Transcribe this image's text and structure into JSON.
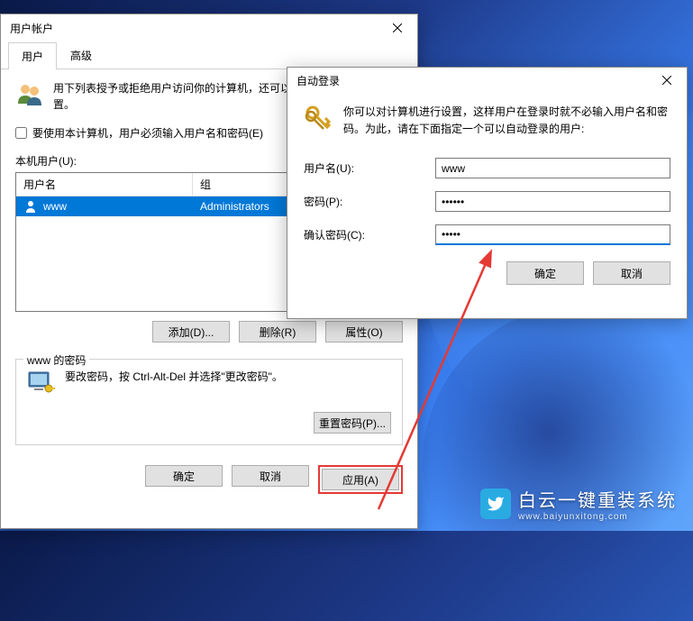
{
  "ua": {
    "title": "用户帐户",
    "tabs": {
      "users": "用户",
      "advanced": "高级"
    },
    "intro": "用下列表授予或拒绝用户访问你的计算机，还可以更改其密码和其他设置。",
    "checkbox": "要使用本计算机，用户必须输入用户名和密码(E)",
    "list_label": "本机用户(U):",
    "cols": {
      "name": "用户名",
      "group": "组"
    },
    "row": {
      "name": "www",
      "group": "Administrators"
    },
    "btns": {
      "add": "添加(D)...",
      "remove": "删除(R)",
      "props": "属性(O)"
    },
    "pw_legend": "www 的密码",
    "pw_text": "要改密码，按 Ctrl-Alt-Del 并选择\"更改密码\"。",
    "reset": "重置密码(P)...",
    "ok": "确定",
    "cancel": "取消",
    "apply": "应用(A)"
  },
  "al": {
    "title": "自动登录",
    "intro": "你可以对计算机进行设置，这样用户在登录时就不必输入用户名和密码。为此，请在下面指定一个可以自动登录的用户:",
    "username_label": "用户名(U):",
    "username": "www",
    "password_label": "密码(P):",
    "password": "••••••",
    "confirm_label": "确认密码(C):",
    "confirm": "•••••",
    "ok": "确定",
    "cancel": "取消"
  },
  "watermark": "白云一键重装系统",
  "watermark_sub": "www.baiyunxitong.com"
}
